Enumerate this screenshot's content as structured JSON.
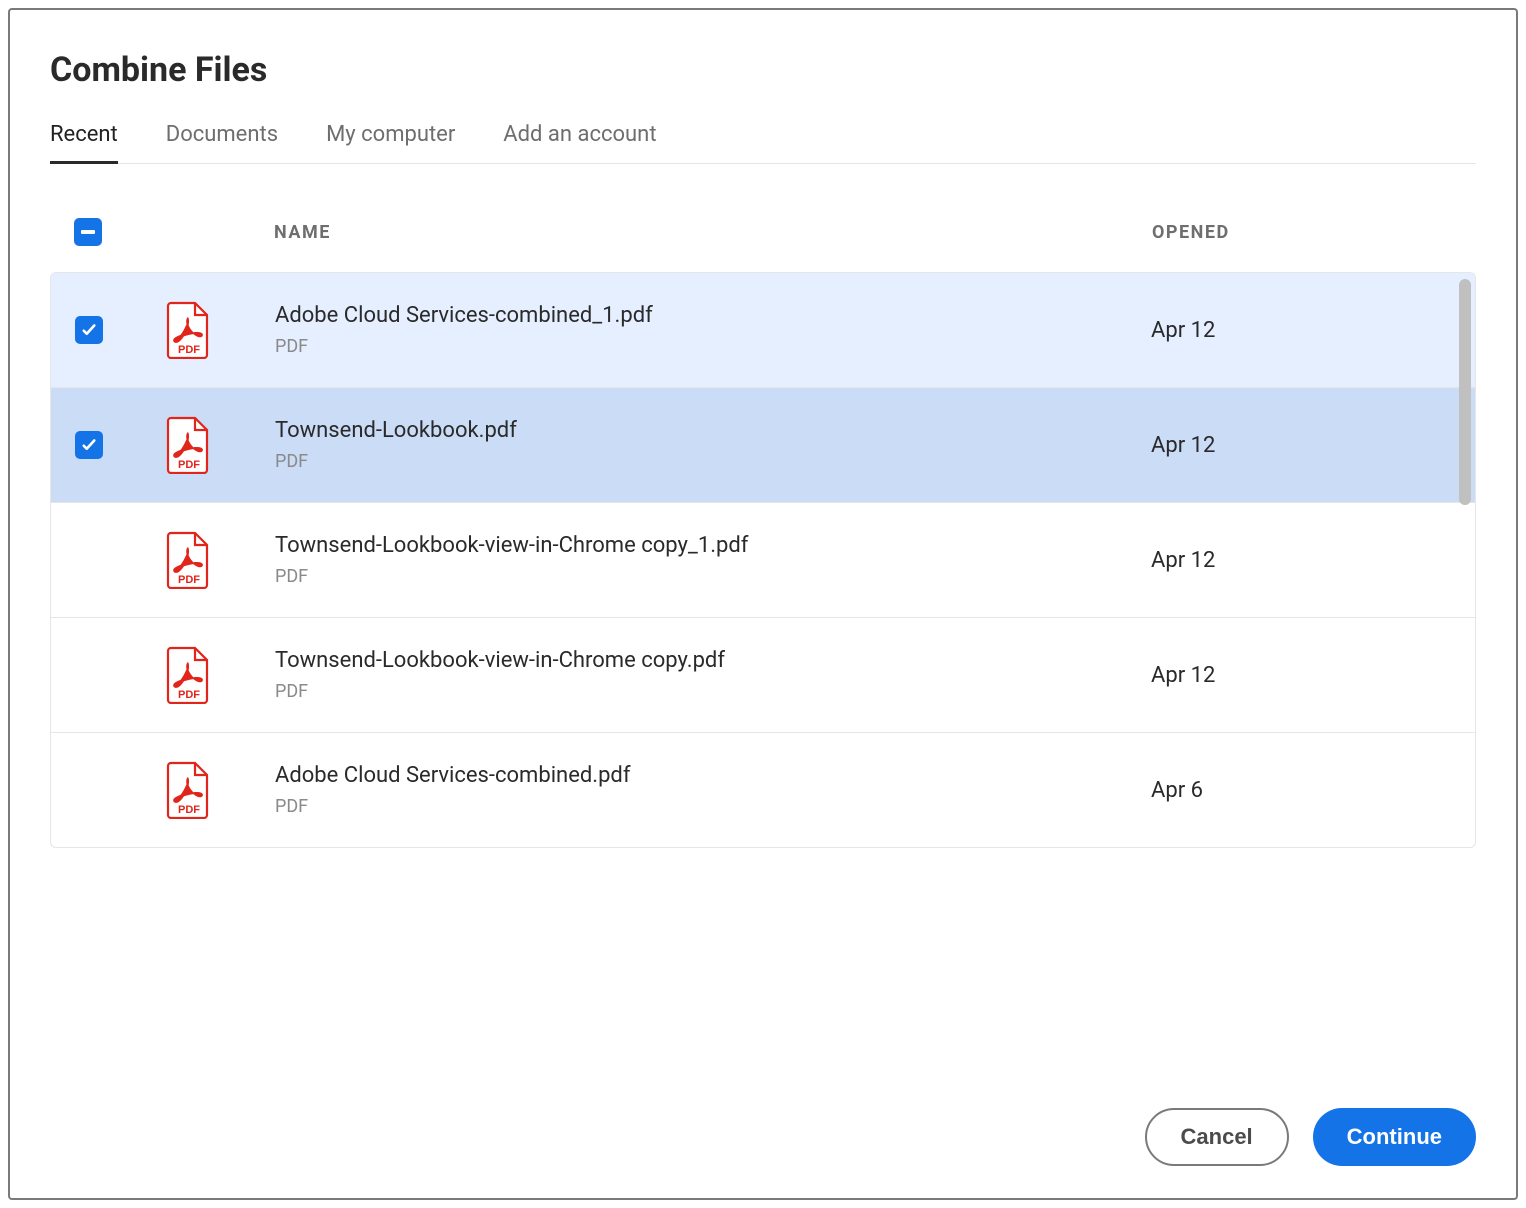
{
  "dialog": {
    "title": "Combine Files"
  },
  "tabs": [
    {
      "label": "Recent",
      "active": true
    },
    {
      "label": "Documents",
      "active": false
    },
    {
      "label": "My computer",
      "active": false
    },
    {
      "label": "Add an account",
      "active": false
    }
  ],
  "columns": {
    "name": "NAME",
    "opened": "OPENED"
  },
  "selectAllState": "indeterminate",
  "files": [
    {
      "name": "Adobe Cloud Services-combined_1.pdf",
      "type": "PDF",
      "opened": "Apr 12",
      "checked": true,
      "highlight": "light"
    },
    {
      "name": "Townsend-Lookbook.pdf",
      "type": "PDF",
      "opened": "Apr 12",
      "checked": true,
      "highlight": "dark"
    },
    {
      "name": "Townsend-Lookbook-view-in-Chrome copy_1.pdf",
      "type": "PDF",
      "opened": "Apr 12",
      "checked": false,
      "highlight": "none"
    },
    {
      "name": "Townsend-Lookbook-view-in-Chrome copy.pdf",
      "type": "PDF",
      "opened": "Apr 12",
      "checked": false,
      "highlight": "none"
    },
    {
      "name": "Adobe Cloud Services-combined.pdf",
      "type": "PDF",
      "opened": "Apr 6",
      "checked": false,
      "highlight": "none"
    }
  ],
  "buttons": {
    "cancel": "Cancel",
    "continue": "Continue"
  }
}
